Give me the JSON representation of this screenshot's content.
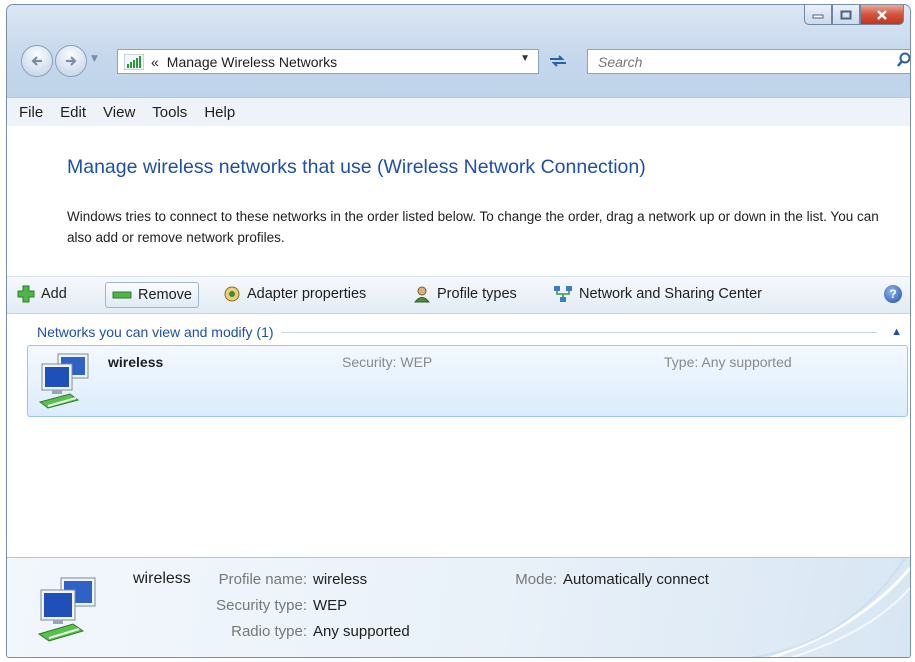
{
  "window": {
    "minimize_icon": "minimize-icon",
    "maximize_icon": "maximize-icon",
    "close_icon": "close-icon"
  },
  "nav": {
    "back_icon": "back-arrow-icon",
    "forward_icon": "forward-arrow-icon",
    "breadcrumb_sep": "«",
    "address": "Manage Wireless Networks",
    "search_placeholder": "Search"
  },
  "menu": [
    "File",
    "Edit",
    "View",
    "Tools",
    "Help"
  ],
  "page": {
    "heading": "Manage wireless networks that use (Wireless Network Connection)",
    "description": "Windows tries to connect to these networks in the order listed below. To change the order, drag a network up or down in the list. You can also add or remove network profiles."
  },
  "toolbar": {
    "add": "Add",
    "remove": "Remove",
    "adapter_properties": "Adapter properties",
    "profile_types": "Profile types",
    "network_sharing_center": "Network and Sharing Center"
  },
  "group": {
    "label": "Networks you can view and modify (1)",
    "networks": [
      {
        "name": "wireless",
        "security": "Security: WEP",
        "type": "Type: Any supported"
      }
    ]
  },
  "details": {
    "name": "wireless",
    "profile_name_label": "Profile name:",
    "profile_name": "wireless",
    "security_type_label": "Security type:",
    "security_type": "WEP",
    "radio_type_label": "Radio type:",
    "radio_type": "Any supported",
    "mode_label": "Mode:",
    "mode": "Automatically connect"
  },
  "colors": {
    "heading_blue": "#1f4fa6",
    "selection_fill": "#dcecfc",
    "selection_border": "#99c5ef"
  }
}
